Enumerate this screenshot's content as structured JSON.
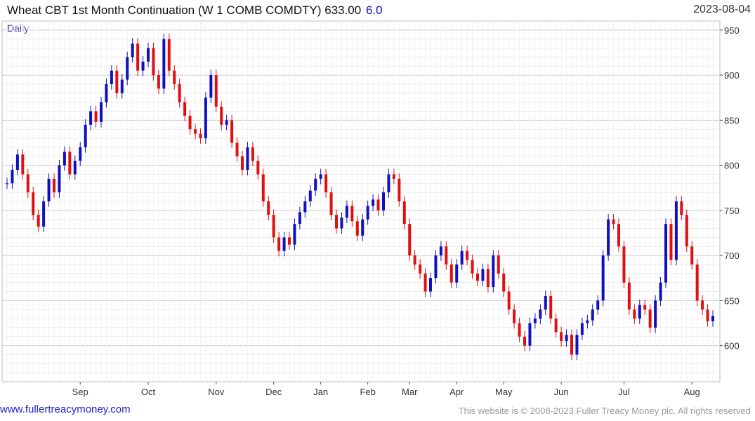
{
  "header": {
    "title": "Wheat CBT 1st Month Continuation (W 1 COMB COMDTY) 633.00",
    "change": "6.0",
    "date": "2023-08-04"
  },
  "footer": {
    "site": "www.fullertreacymoney.com",
    "copyright": "This website is © 2008-2023 Fuller Treacy Money plc. All rights reserved"
  },
  "chart_data": {
    "type": "candlestick",
    "period_label": "Daily",
    "ylim": [
      560,
      960
    ],
    "y_ticks": [
      600,
      650,
      700,
      750,
      800,
      850,
      900,
      950
    ],
    "x_ticks": [
      "Sep",
      "Oct",
      "Nov",
      "Dec",
      "Jan",
      "Feb",
      "Mar",
      "Apr",
      "May",
      "Jun",
      "Jul",
      "Aug"
    ],
    "up_color": "#1010c0",
    "down_color": "#e01010",
    "grid": true,
    "close_series": [
      {
        "x": "Aug",
        "y": 780
      },
      {
        "x": "Aug",
        "y": 795
      },
      {
        "x": "Aug",
        "y": 812
      },
      {
        "x": "Aug",
        "y": 790
      },
      {
        "x": "Aug",
        "y": 770
      },
      {
        "x": "Aug",
        "y": 745
      },
      {
        "x": "Aug",
        "y": 732
      },
      {
        "x": "Aug",
        "y": 760
      },
      {
        "x": "Aug",
        "y": 785
      },
      {
        "x": "Aug",
        "y": 770
      },
      {
        "x": "Aug",
        "y": 800
      },
      {
        "x": "Aug",
        "y": 815
      },
      {
        "x": "Aug",
        "y": 790
      },
      {
        "x": "Aug",
        "y": 805
      },
      {
        "x": "Sep",
        "y": 820
      },
      {
        "x": "Sep",
        "y": 845
      },
      {
        "x": "Sep",
        "y": 860
      },
      {
        "x": "Sep",
        "y": 848
      },
      {
        "x": "Sep",
        "y": 870
      },
      {
        "x": "Sep",
        "y": 890
      },
      {
        "x": "Sep",
        "y": 905
      },
      {
        "x": "Sep",
        "y": 880
      },
      {
        "x": "Sep",
        "y": 895
      },
      {
        "x": "Sep",
        "y": 920
      },
      {
        "x": "Sep",
        "y": 935
      },
      {
        "x": "Sep",
        "y": 905
      },
      {
        "x": "Sep",
        "y": 915
      },
      {
        "x": "Oct",
        "y": 930
      },
      {
        "x": "Oct",
        "y": 900
      },
      {
        "x": "Oct",
        "y": 885
      },
      {
        "x": "Oct",
        "y": 940
      },
      {
        "x": "Oct",
        "y": 905
      },
      {
        "x": "Oct",
        "y": 890
      },
      {
        "x": "Oct",
        "y": 870
      },
      {
        "x": "Oct",
        "y": 855
      },
      {
        "x": "Oct",
        "y": 840
      },
      {
        "x": "Oct",
        "y": 835
      },
      {
        "x": "Oct",
        "y": 830
      },
      {
        "x": "Oct",
        "y": 875
      },
      {
        "x": "Oct",
        "y": 900
      },
      {
        "x": "Nov",
        "y": 865
      },
      {
        "x": "Nov",
        "y": 845
      },
      {
        "x": "Nov",
        "y": 850
      },
      {
        "x": "Nov",
        "y": 825
      },
      {
        "x": "Nov",
        "y": 810
      },
      {
        "x": "Nov",
        "y": 795
      },
      {
        "x": "Nov",
        "y": 820
      },
      {
        "x": "Nov",
        "y": 805
      },
      {
        "x": "Nov",
        "y": 790
      },
      {
        "x": "Nov",
        "y": 760
      },
      {
        "x": "Nov",
        "y": 745
      },
      {
        "x": "Dec",
        "y": 720
      },
      {
        "x": "Dec",
        "y": 705
      },
      {
        "x": "Dec",
        "y": 720
      },
      {
        "x": "Dec",
        "y": 712
      },
      {
        "x": "Dec",
        "y": 735
      },
      {
        "x": "Dec",
        "y": 748
      },
      {
        "x": "Dec",
        "y": 760
      },
      {
        "x": "Dec",
        "y": 772
      },
      {
        "x": "Dec",
        "y": 785
      },
      {
        "x": "Jan",
        "y": 790
      },
      {
        "x": "Jan",
        "y": 770
      },
      {
        "x": "Jan",
        "y": 745
      },
      {
        "x": "Jan",
        "y": 730
      },
      {
        "x": "Jan",
        "y": 742
      },
      {
        "x": "Jan",
        "y": 755
      },
      {
        "x": "Jan",
        "y": 738
      },
      {
        "x": "Jan",
        "y": 722
      },
      {
        "x": "Jan",
        "y": 740
      },
      {
        "x": "Feb",
        "y": 755
      },
      {
        "x": "Feb",
        "y": 762
      },
      {
        "x": "Feb",
        "y": 750
      },
      {
        "x": "Feb",
        "y": 770
      },
      {
        "x": "Feb",
        "y": 790
      },
      {
        "x": "Feb",
        "y": 785
      },
      {
        "x": "Feb",
        "y": 760
      },
      {
        "x": "Feb",
        "y": 735
      },
      {
        "x": "Mar",
        "y": 700
      },
      {
        "x": "Mar",
        "y": 690
      },
      {
        "x": "Mar",
        "y": 680
      },
      {
        "x": "Mar",
        "y": 660
      },
      {
        "x": "Mar",
        "y": 675
      },
      {
        "x": "Mar",
        "y": 700
      },
      {
        "x": "Mar",
        "y": 710
      },
      {
        "x": "Mar",
        "y": 690
      },
      {
        "x": "Mar",
        "y": 670
      },
      {
        "x": "Apr",
        "y": 690
      },
      {
        "x": "Apr",
        "y": 705
      },
      {
        "x": "Apr",
        "y": 695
      },
      {
        "x": "Apr",
        "y": 680
      },
      {
        "x": "Apr",
        "y": 672
      },
      {
        "x": "Apr",
        "y": 685
      },
      {
        "x": "Apr",
        "y": 665
      },
      {
        "x": "Apr",
        "y": 700
      },
      {
        "x": "Apr",
        "y": 680
      },
      {
        "x": "May",
        "y": 660
      },
      {
        "x": "May",
        "y": 640
      },
      {
        "x": "May",
        "y": 625
      },
      {
        "x": "May",
        "y": 610
      },
      {
        "x": "May",
        "y": 600
      },
      {
        "x": "May",
        "y": 625
      },
      {
        "x": "May",
        "y": 630
      },
      {
        "x": "May",
        "y": 640
      },
      {
        "x": "May",
        "y": 655
      },
      {
        "x": "May",
        "y": 630
      },
      {
        "x": "May",
        "y": 615
      },
      {
        "x": "Jun",
        "y": 605
      },
      {
        "x": "Jun",
        "y": 612
      },
      {
        "x": "Jun",
        "y": 590
      },
      {
        "x": "Jun",
        "y": 612
      },
      {
        "x": "Jun",
        "y": 625
      },
      {
        "x": "Jun",
        "y": 628
      },
      {
        "x": "Jun",
        "y": 640
      },
      {
        "x": "Jun",
        "y": 650
      },
      {
        "x": "Jun",
        "y": 700
      },
      {
        "x": "Jun",
        "y": 740
      },
      {
        "x": "Jun",
        "y": 735
      },
      {
        "x": "Jun",
        "y": 710
      },
      {
        "x": "Jul",
        "y": 670
      },
      {
        "x": "Jul",
        "y": 640
      },
      {
        "x": "Jul",
        "y": 630
      },
      {
        "x": "Jul",
        "y": 645
      },
      {
        "x": "Jul",
        "y": 640
      },
      {
        "x": "Jul",
        "y": 620
      },
      {
        "x": "Jul",
        "y": 650
      },
      {
        "x": "Jul",
        "y": 670
      },
      {
        "x": "Jul",
        "y": 735
      },
      {
        "x": "Jul",
        "y": 695
      },
      {
        "x": "Jul",
        "y": 760
      },
      {
        "x": "Jul",
        "y": 745
      },
      {
        "x": "Jul",
        "y": 710
      },
      {
        "x": "Aug",
        "y": 690
      },
      {
        "x": "Aug",
        "y": 650
      },
      {
        "x": "Aug",
        "y": 640
      },
      {
        "x": "Aug",
        "y": 627
      },
      {
        "x": "Aug",
        "y": 633
      }
    ]
  }
}
